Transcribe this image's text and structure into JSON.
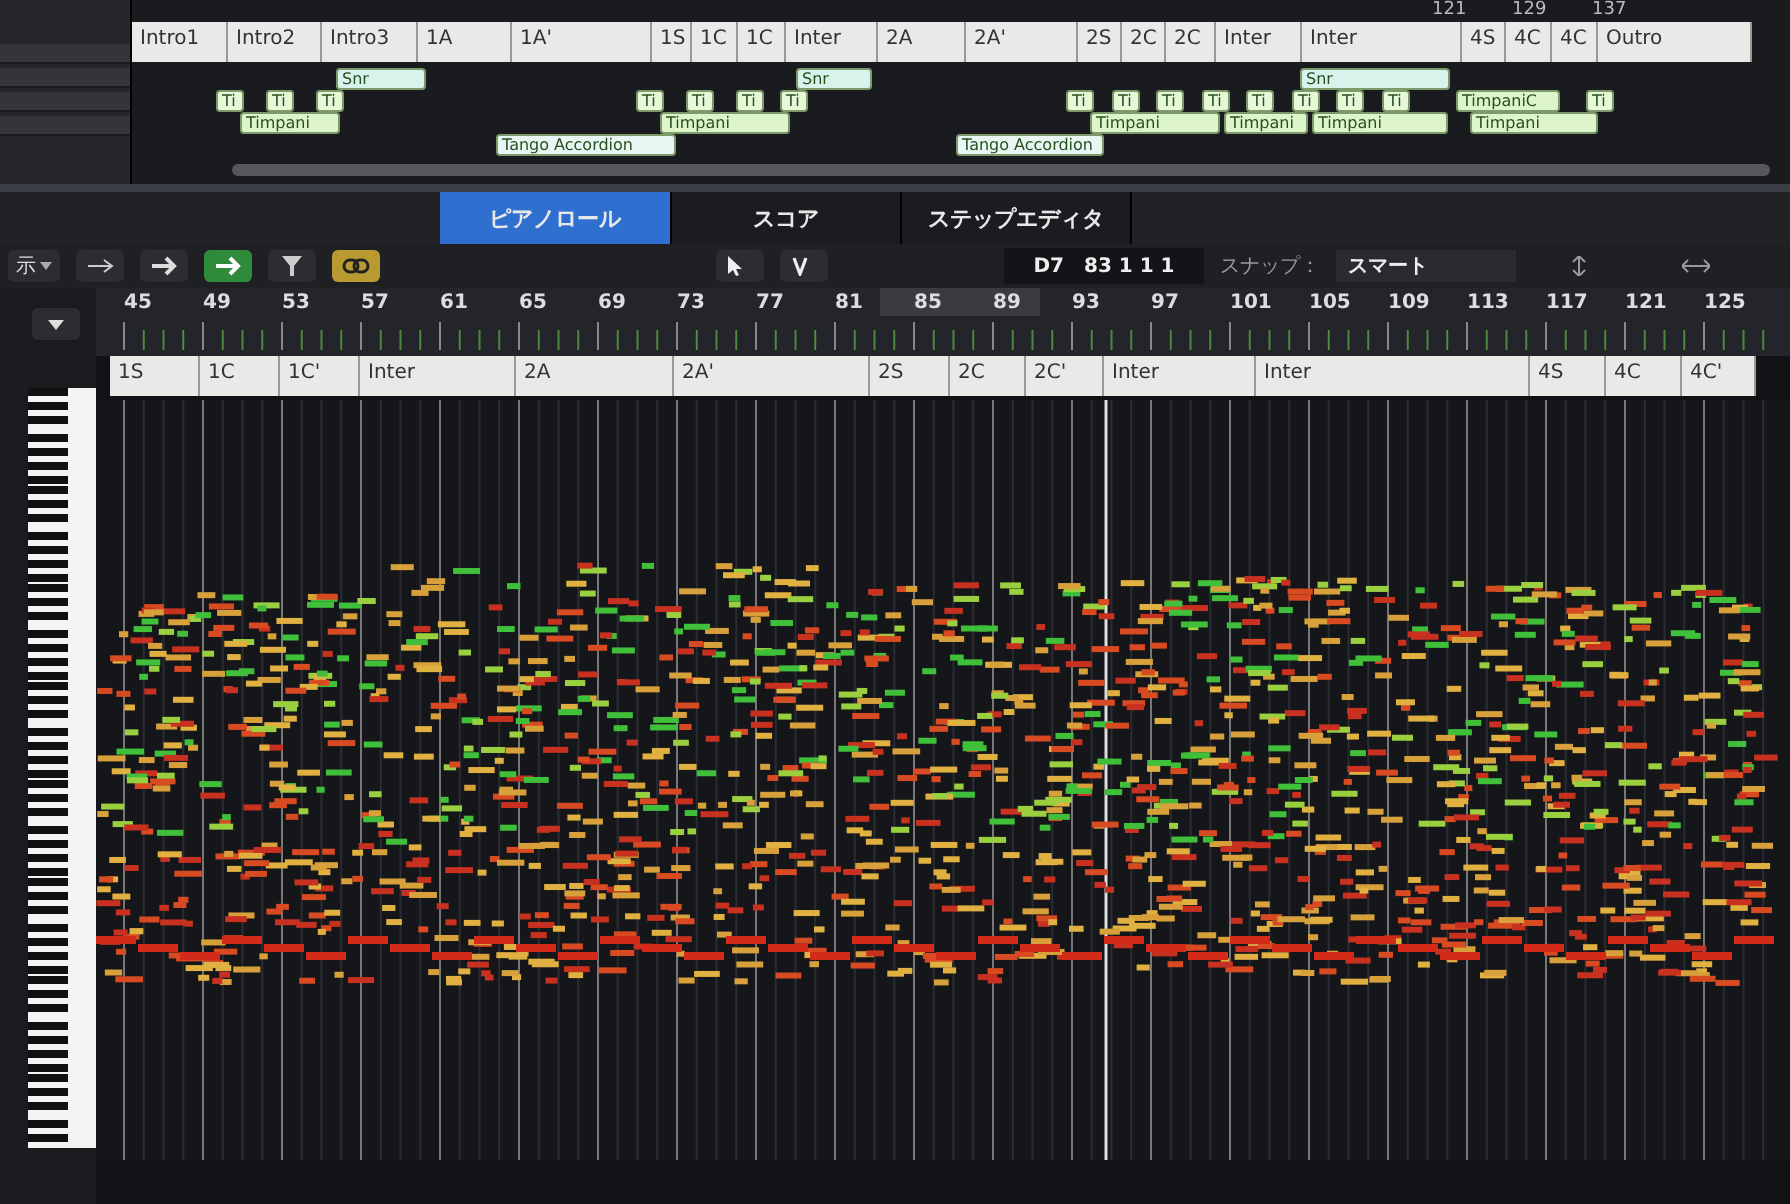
{
  "arrange": {
    "ruler": [
      "121",
      "129",
      "137"
    ],
    "markers": [
      "Intro1",
      "Intro2",
      "Intro3",
      "1A",
      "1A'",
      "1S",
      "1C",
      "1C",
      "Inter",
      "2A",
      "2A'",
      "2S",
      "2C",
      "2C",
      "Inter",
      "Inter",
      "4S",
      "4C",
      "4C",
      "Outro"
    ],
    "regions": [
      {
        "kind": "snr",
        "label": "Snr"
      },
      {
        "kind": "snr",
        "label": "Snr"
      },
      {
        "kind": "snr",
        "label": "Snr"
      },
      {
        "kind": "ti",
        "label": "Ti"
      },
      {
        "kind": "ti",
        "label": "Ti"
      },
      {
        "kind": "ti",
        "label": "Ti"
      },
      {
        "kind": "ti",
        "label": "Ti"
      },
      {
        "kind": "ti",
        "label": "Ti"
      },
      {
        "kind": "ti",
        "label": "Ti"
      },
      {
        "kind": "ti",
        "label": "Ti"
      },
      {
        "kind": "ti",
        "label": "Ti"
      },
      {
        "kind": "ti",
        "label": "Ti"
      },
      {
        "kind": "ti",
        "label": "Ti"
      },
      {
        "kind": "ti",
        "label": "Ti"
      },
      {
        "kind": "ti",
        "label": "Ti"
      },
      {
        "kind": "ti",
        "label": "Ti"
      },
      {
        "kind": "ti",
        "label": "Ti"
      },
      {
        "kind": "ti",
        "label": "Ti"
      },
      {
        "kind": "timpani",
        "label": "TimpaniC"
      },
      {
        "kind": "ti",
        "label": "Ti"
      },
      {
        "kind": "timpani",
        "label": "Timpani"
      },
      {
        "kind": "timpani",
        "label": "Timpani"
      },
      {
        "kind": "timpani",
        "label": "Timpani"
      },
      {
        "kind": "timpani",
        "label": "Timpani"
      },
      {
        "kind": "timpani",
        "label": "Timpani"
      },
      {
        "kind": "timpani",
        "label": "Timpani"
      },
      {
        "kind": "accordion",
        "label": "Tango Accordion"
      },
      {
        "kind": "accordion",
        "label": "Tango Accordion"
      }
    ]
  },
  "tabs": [
    {
      "label": "ピアノロール",
      "selected": true
    },
    {
      "label": "スコア",
      "selected": false
    },
    {
      "label": "ステップエディタ",
      "selected": false
    }
  ],
  "toolbar": {
    "view_menu": "示",
    "position_chord": "D7",
    "position": "83 1 1 1",
    "snap_label": "スナップ：",
    "snap_value": "スマート"
  },
  "piano_roll": {
    "ruler": [
      "45",
      "49",
      "53",
      "57",
      "61",
      "65",
      "69",
      "73",
      "77",
      "81",
      "85",
      "89",
      "93",
      "97",
      "101",
      "105",
      "109",
      "113",
      "117",
      "121",
      "125"
    ],
    "markers": [
      "1S",
      "1C",
      "1C'",
      "Inter",
      "2A",
      "2A'",
      "2S",
      "2C",
      "2C'",
      "Inter",
      "Inter",
      "4S",
      "4C",
      "4C'"
    ]
  }
}
